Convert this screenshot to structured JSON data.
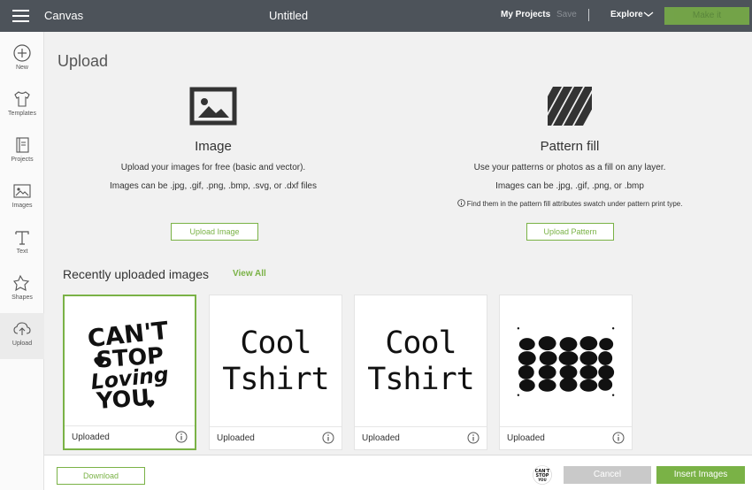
{
  "topbar": {
    "app_title": "Canvas",
    "doc_title": "Untitled",
    "my_projects": "My Projects",
    "save": "Save",
    "explore": "Explore",
    "make_it": "Make it"
  },
  "sidebar": {
    "items": [
      {
        "label": "New",
        "icon": "plus-circle-icon"
      },
      {
        "label": "Templates",
        "icon": "tshirt-icon"
      },
      {
        "label": "Projects",
        "icon": "projects-icon"
      },
      {
        "label": "Images",
        "icon": "image-icon"
      },
      {
        "label": "Text",
        "icon": "text-icon"
      },
      {
        "label": "Shapes",
        "icon": "shapes-icon"
      },
      {
        "label": "Upload",
        "icon": "cloud-upload-icon",
        "active": true
      }
    ]
  },
  "main": {
    "title": "Upload",
    "image_section": {
      "title": "Image",
      "desc": "Upload your images for free (basic and vector).",
      "formats": "Images can be .jpg, .gif, .png, .bmp, .svg, or .dxf files",
      "button": "Upload Image"
    },
    "pattern_section": {
      "title": "Pattern fill",
      "desc": "Use your patterns or photos as a fill on any layer.",
      "formats": "Images can be .jpg, .gif, .png, or .bmp",
      "note": "Find them in the pattern fill attributes swatch under pattern print type.",
      "button": "Upload Pattern"
    },
    "recent": {
      "title": "Recently uploaded images",
      "view_all": "View All",
      "cards": [
        {
          "status": "Uploaded",
          "art": "cant-stop-loving-you",
          "lines": [
            "CAN'T",
            "STOP",
            "Loving",
            "YOU"
          ],
          "selected": true
        },
        {
          "status": "Uploaded",
          "art": "cool-tshirt",
          "lines": [
            "Cool",
            "Tshirt"
          ]
        },
        {
          "status": "Uploaded",
          "art": "cool-tshirt",
          "lines": [
            "Cool",
            "Tshirt"
          ]
        },
        {
          "status": "Uploaded",
          "art": "black-blobs-grid"
        }
      ]
    }
  },
  "bottombar": {
    "download": "Download",
    "cancel": "Cancel",
    "insert": "Insert Images"
  },
  "colors": {
    "accent_green": "#7ab246",
    "topbar": "#4d535a"
  }
}
